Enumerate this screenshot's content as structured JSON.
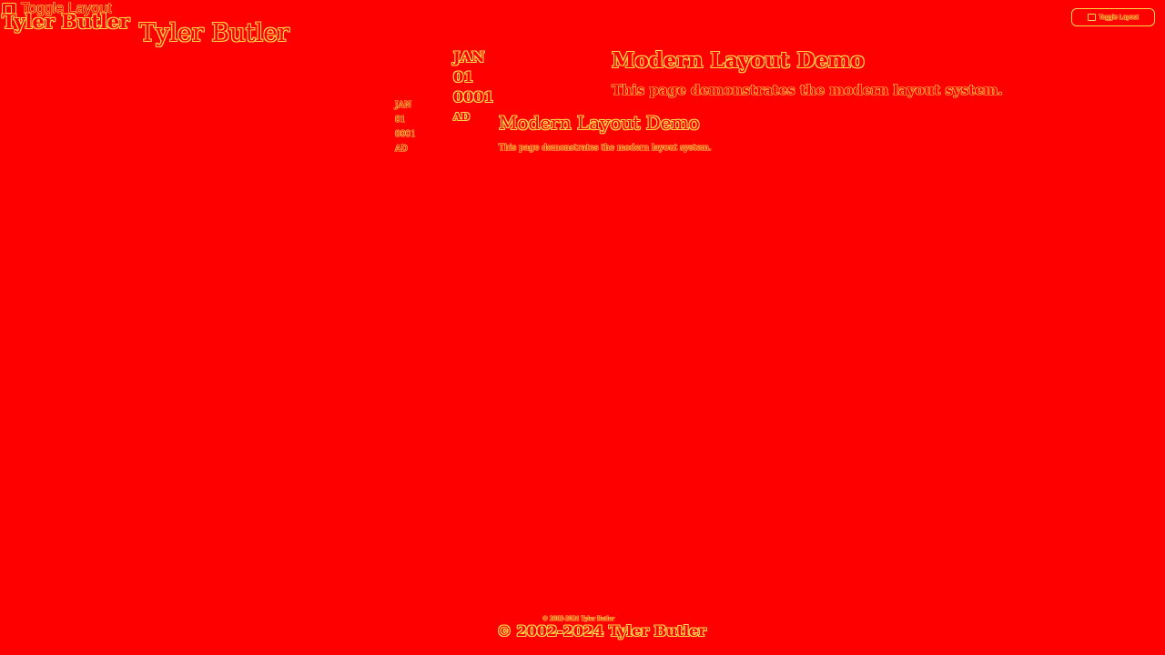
{
  "header": {
    "toggle_label": "Toggle Layout",
    "site_name": "Tyler Butler",
    "site_name_large": "Tyler Butler",
    "toggle_right_label": "Toggle Layout"
  },
  "post": {
    "date": {
      "month": "JAN",
      "day": "01",
      "year": "0001",
      "era": "AD"
    },
    "title": "Modern Layout Demo",
    "description": "This page demonstrates the modern layout system.",
    "date_small": {
      "month": "JAN",
      "day": "01",
      "year": "0001",
      "era": "AD"
    },
    "title_small": "Modern Layout Demo",
    "description_small": "This page demonstrates the modern layout system."
  },
  "footer": {
    "copyright": "© 2002-2024 Tyler Butler",
    "copyright_small": "© 2002-2024 Tyler Butler"
  },
  "colors": {
    "background": "#ff0000",
    "accent": "#ffd84a"
  },
  "icons": {
    "toggle": "layout-toggle-icon"
  }
}
